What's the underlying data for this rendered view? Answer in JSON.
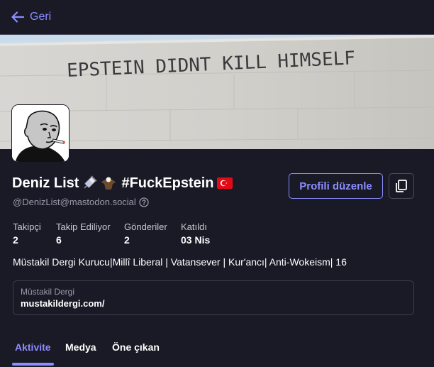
{
  "nav": {
    "back_label": "Geri"
  },
  "banner": {
    "graffiti_text": "EPSTEIN DIDNT KILL HIMSELF"
  },
  "profile": {
    "display_name": "Deniz List",
    "hashtag": "#FuckEpstein",
    "handle": "@DenizList@mastodon.social",
    "edit_label": "Profili düzenle",
    "stats": [
      {
        "label": "Takipçi",
        "value": "2"
      },
      {
        "label": "Takip Ediliyor",
        "value": "6"
      },
      {
        "label": "Gönderiler",
        "value": "2"
      },
      {
        "label": "Katıldı",
        "value": "03 Nis"
      }
    ],
    "bio": "Müstakil Dergi Kurucu|Millî Liberal | Vatansever | Kur'ancı| Anti-Wokeism| 16",
    "fields": [
      {
        "name": "Müstakil Dergi",
        "value": "mustakildergi.com/"
      }
    ]
  },
  "tabs": [
    {
      "label": "Aktivite",
      "active": true
    },
    {
      "label": "Medya",
      "active": false
    },
    {
      "label": "Öne çıkan",
      "active": false
    }
  ],
  "colors": {
    "accent": "#8c8dff",
    "background": "#191a26",
    "muted_text": "#9a9bab"
  }
}
